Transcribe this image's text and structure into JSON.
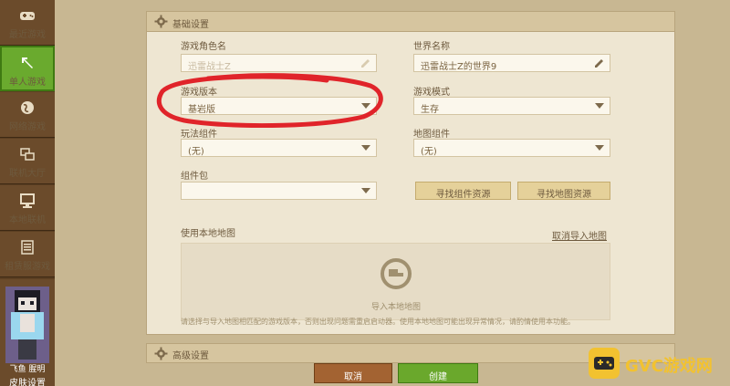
{
  "sidebar": {
    "items": [
      {
        "label": "最近游戏",
        "icon": "gamepad-icon"
      },
      {
        "label": "单人游戏",
        "icon": "pickaxe-icon"
      },
      {
        "label": "网络游戏",
        "icon": "globe-icon"
      },
      {
        "label": "联机大厅",
        "icon": "lobby-icon"
      },
      {
        "label": "本地联机",
        "icon": "monitor-icon"
      },
      {
        "label": "租赁服游戏",
        "icon": "server-list-icon"
      }
    ],
    "skin": {
      "player_name": "飞鱼 腥明",
      "button_label": "皮肤设置"
    }
  },
  "basic_settings": {
    "title": "基础设置",
    "character_name": {
      "label": "游戏角色名",
      "value": "迅雷战士Z"
    },
    "world_name": {
      "label": "世界名称",
      "value": "迅雷战士Z的世界9"
    },
    "game_version": {
      "label": "游戏版本",
      "value": "基岩版"
    },
    "game_mode": {
      "label": "游戏模式",
      "value": "生存"
    },
    "gameplay_component": {
      "label": "玩法组件",
      "value": "(无)"
    },
    "map_component": {
      "label": "地图组件",
      "value": "(无)"
    },
    "component_pack": {
      "label": "组件包",
      "value": ""
    },
    "find_component_button": "寻找组件资源",
    "find_map_button": "寻找地图资源",
    "local_map": {
      "label": "使用本地地图",
      "cancel_import_link": "取消导入地图",
      "import_label": "导入本地地图",
      "hint": "请选择与导入地图相匹配的游戏版本，否则出现问题需重启启动器。使用本地地图可能出现异常情况，请酌情使用本功能。"
    }
  },
  "advanced_settings": {
    "title": "高级设置"
  },
  "footer": {
    "cancel_label": "取消",
    "create_label": "创建"
  },
  "watermark": {
    "text": "GVC游戏网"
  },
  "colors": {
    "sidebar_bg": "#6b4b2b",
    "sidebar_active": "#6aaa2e",
    "panel_bg": "#eee6d2",
    "header_bg": "#d6c59f",
    "cancel_bg": "#a36332",
    "create_bg": "#6aa82c",
    "annotation": "#e0242a"
  }
}
